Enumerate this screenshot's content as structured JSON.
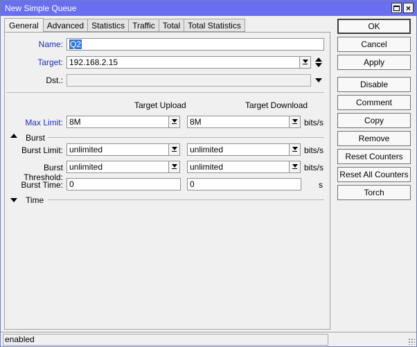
{
  "window": {
    "title": "New Simple Queue",
    "maximize_icon": "maximize-icon",
    "close_symbol": "×"
  },
  "tabs": [
    {
      "label": "General",
      "active": true
    },
    {
      "label": "Advanced"
    },
    {
      "label": "Statistics"
    },
    {
      "label": "Traffic"
    },
    {
      "label": "Total"
    },
    {
      "label": "Total Statistics"
    }
  ],
  "general": {
    "name": {
      "label": "Name:",
      "value": "Q2"
    },
    "target": {
      "label": "Target:",
      "value": "192.168.2.15"
    },
    "dst": {
      "label": "Dst.:",
      "value": ""
    },
    "col_upload": "Target Upload",
    "col_download": "Target Download",
    "max_limit": {
      "label": "Max Limit:",
      "upload": "8M",
      "download": "8M",
      "units": "bits/s"
    },
    "burst_section": "Burst",
    "burst_limit": {
      "label": "Burst Limit:",
      "upload": "unlimited",
      "download": "unlimited",
      "units": "bits/s"
    },
    "burst_threshold": {
      "label": "Burst Threshold:",
      "upload": "unlimited",
      "download": "unlimited",
      "units": "bits/s"
    },
    "burst_time": {
      "label": "Burst Time:",
      "upload": "0",
      "download": "0",
      "units": "s"
    },
    "time_section": "Time"
  },
  "buttons": {
    "ok": "OK",
    "cancel": "Cancel",
    "apply": "Apply",
    "disable": "Disable",
    "comment": "Comment",
    "copy": "Copy",
    "remove": "Remove",
    "reset_counters": "Reset Counters",
    "reset_all_counters": "Reset All Counters",
    "torch": "Torch"
  },
  "status": {
    "text": "enabled"
  },
  "colors": {
    "titlebar": "#6a6ff0",
    "label_blue": "#1c2dba",
    "selection": "#3377dd"
  }
}
